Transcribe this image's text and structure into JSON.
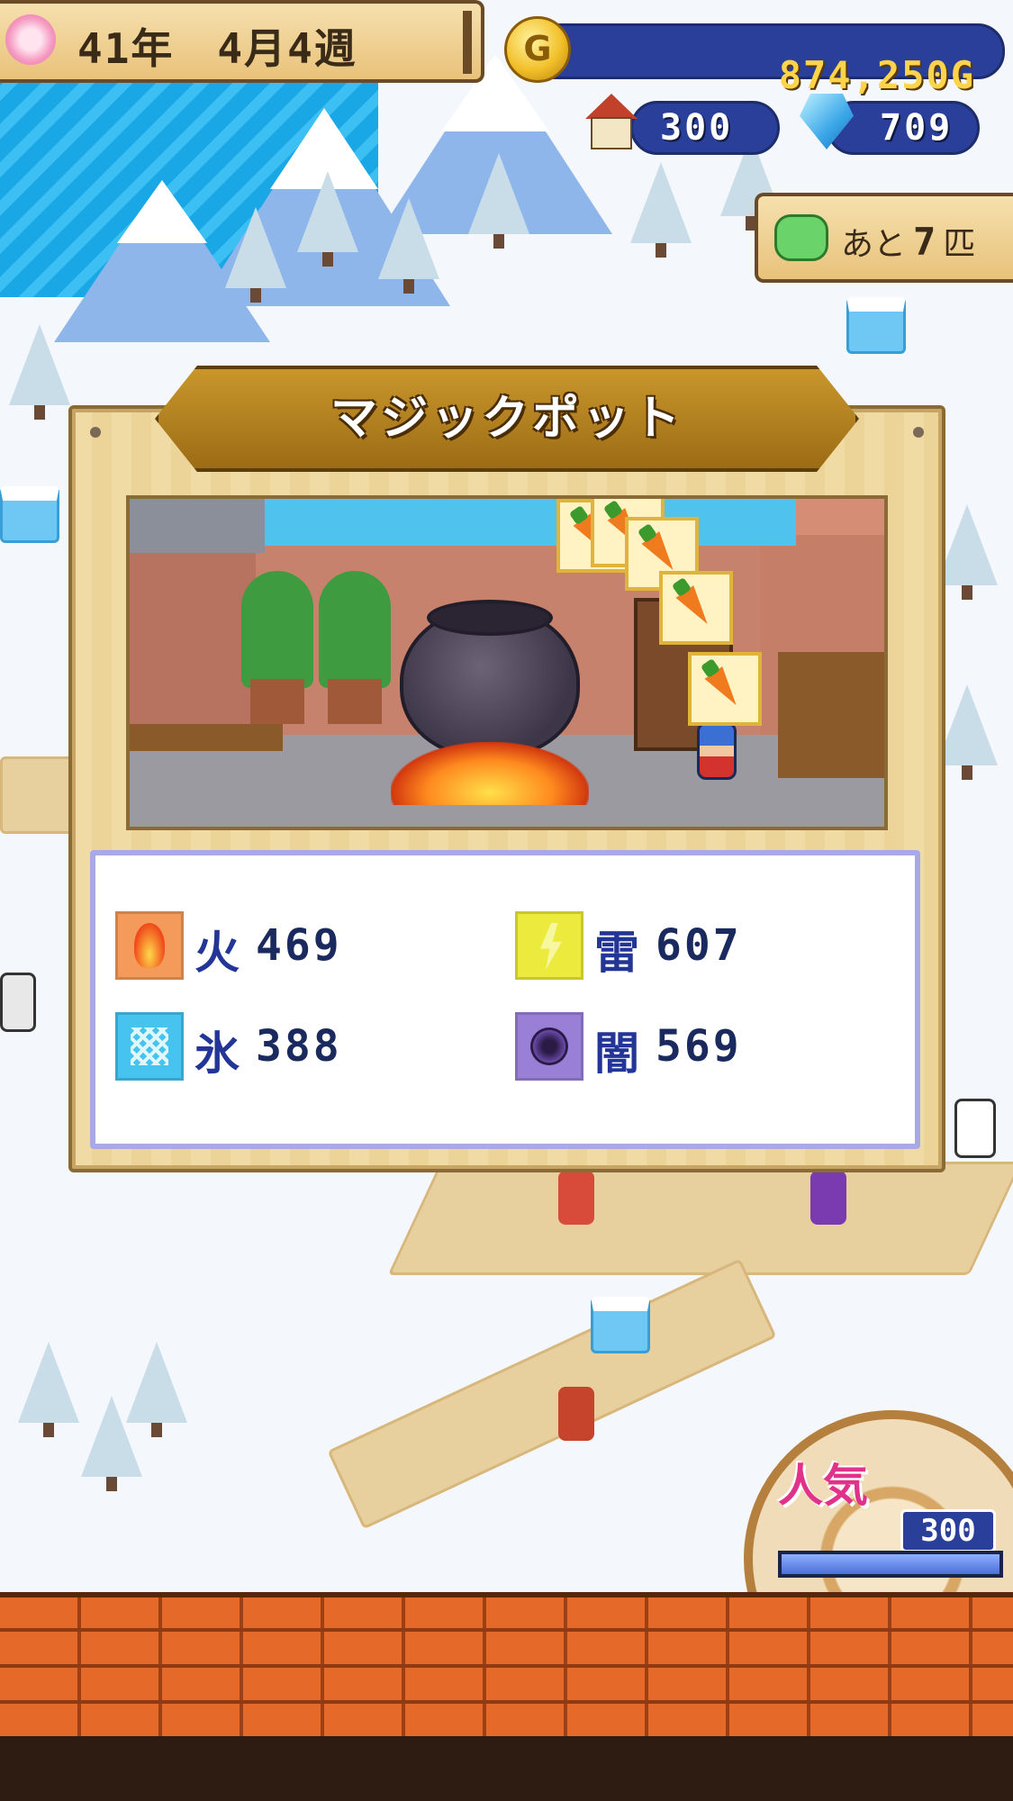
{
  "hud": {
    "date": "41年　4月4週",
    "gold": {
      "icon_letter": "G",
      "amount": "874,250G"
    },
    "houses": "300",
    "crystals": "709",
    "remaining": {
      "prefix": "あと",
      "count": "7",
      "suffix": "匹"
    }
  },
  "modal": {
    "title": "マジックポット",
    "stats": [
      {
        "icon": "fire-icon",
        "label": "火",
        "value": "469"
      },
      {
        "icon": "thunder-icon",
        "label": "雷",
        "value": "607"
      },
      {
        "icon": "ice-icon",
        "label": "氷",
        "value": "388"
      },
      {
        "icon": "dark-icon",
        "label": "闇",
        "value": "569"
      }
    ],
    "ingredient_cards": [
      "carrot-icon",
      "carrot-icon",
      "carrot-icon",
      "carrot-icon",
      "carrot-icon"
    ]
  },
  "popularity": {
    "label": "人気",
    "value": "300",
    "level_fraction": 1.0
  },
  "colors": {
    "stat_text": "#233596",
    "gold_text": "#ffd44a",
    "popular_label": "#e0328a"
  }
}
